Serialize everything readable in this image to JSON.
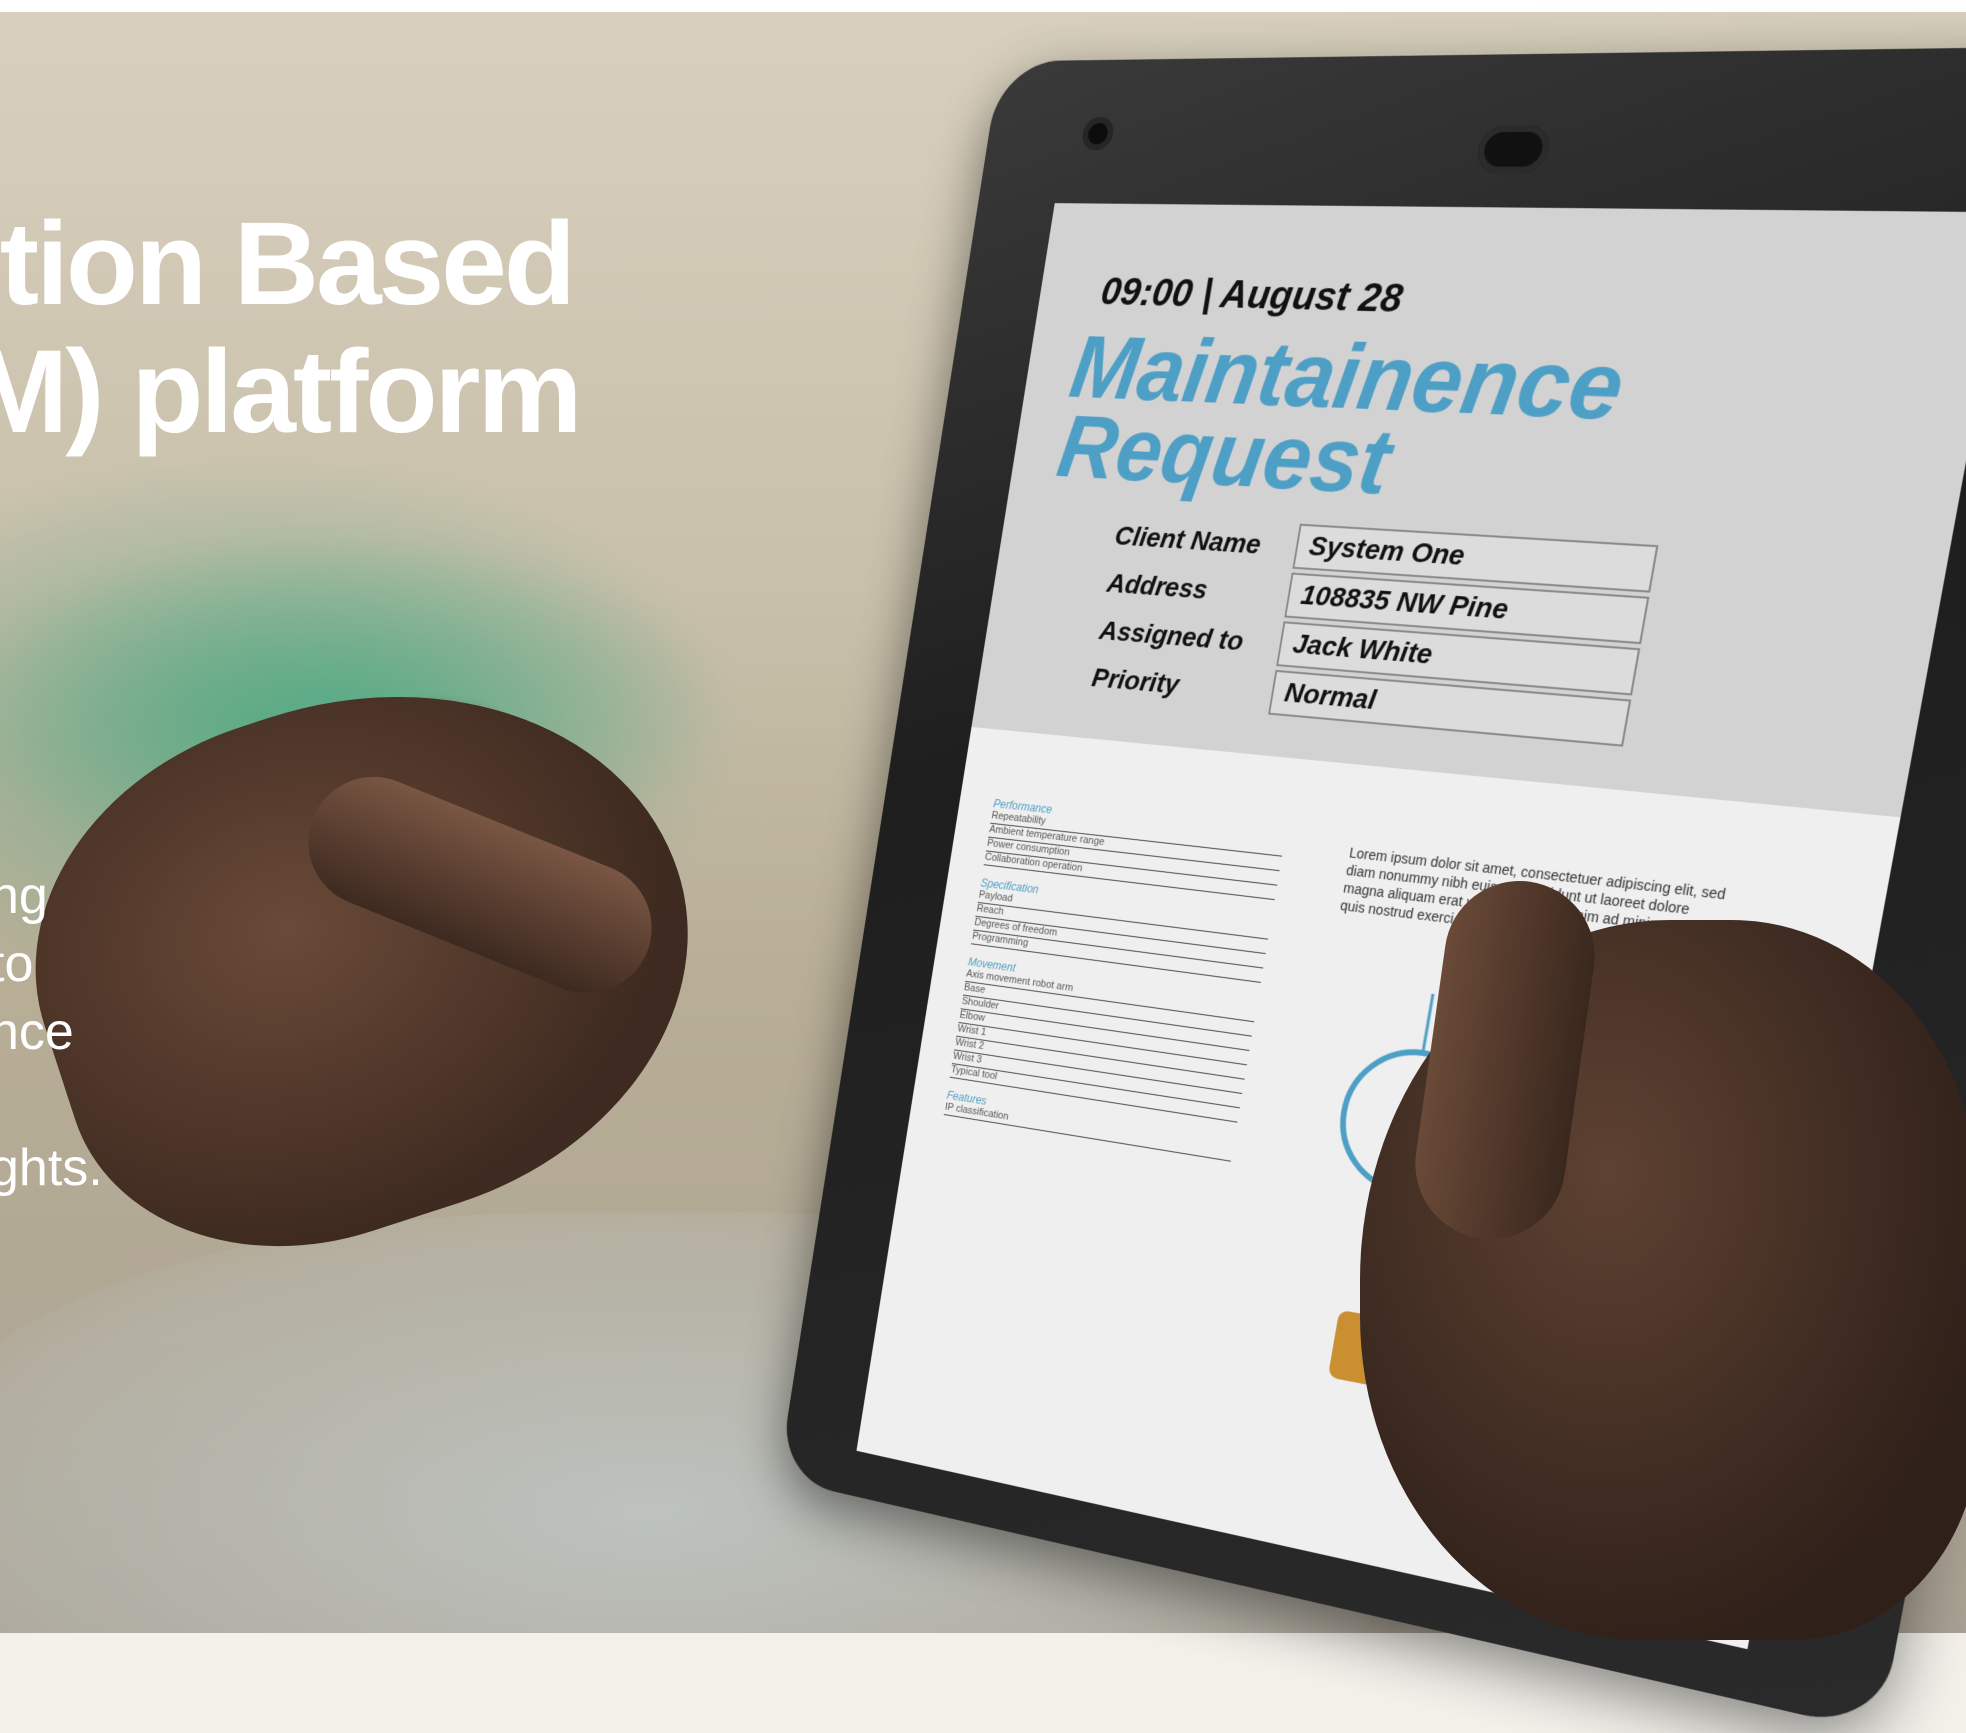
{
  "overlay": {
    "headline_line1": "ition Based",
    "headline_line2": "M) platform",
    "body_fragments": [
      "ng",
      "to",
      "nce",
      "",
      "ghts."
    ]
  },
  "tablet_screen": {
    "time": "09:00",
    "date": "August 28",
    "title_line1": "Maintainence",
    "title_line2": "Request",
    "fields": [
      {
        "label": "Client Name",
        "value": "System One"
      },
      {
        "label": "Address",
        "value": "108835 NW Pine"
      },
      {
        "label": "Assigned to",
        "value": "Jack White"
      },
      {
        "label": "Priority",
        "value": "Normal"
      }
    ],
    "spec_headers": [
      "Performance",
      "Specification",
      "Movement",
      "Features"
    ],
    "spec_rows": [
      "Repeatability",
      "Ambient temperature range",
      "Power consumption",
      "Collaboration operation",
      "Payload",
      "Reach",
      "Degrees of freedom",
      "Programming",
      "Axis movement robot arm",
      "Base",
      "Shoulder",
      "Elbow",
      "Wrist 1",
      "Wrist 2",
      "Wrist 3",
      "Typical tool",
      "IP classification"
    ],
    "lorem": "Lorem ipsum dolor sit amet, consectetuer adipiscing elit, sed diam nonummy nibh euismod tincidunt ut laoreet dolore magna aliquam erat volutpat. Ut wisi enim ad minim veniam, quis nostrud exerci tation ullamcorper suscipit lobortis nisl ut"
  },
  "colors": {
    "title_blue": "#4e9fc6",
    "overlay_text": "#ffffff",
    "robot_orange": "#d9a23f"
  }
}
